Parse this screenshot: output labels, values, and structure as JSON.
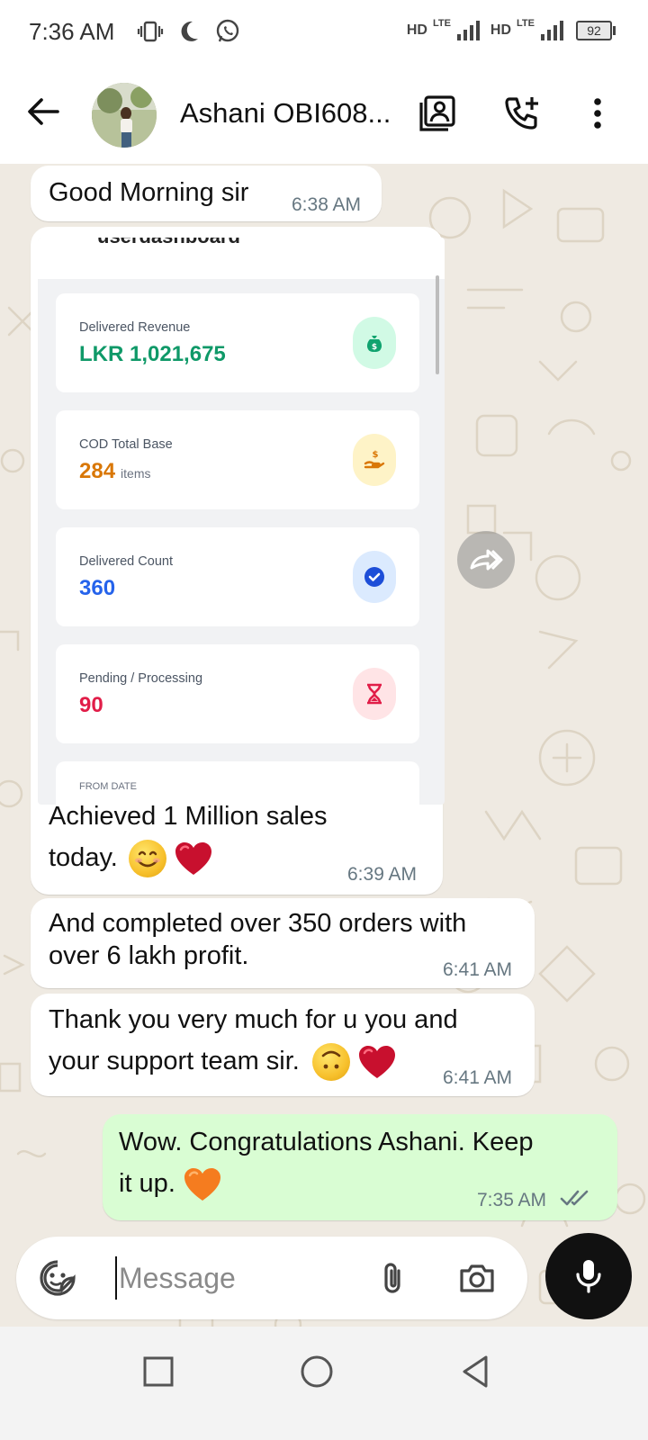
{
  "status_bar": {
    "time": "7:36 AM",
    "network1": "HD",
    "lte1": "LTE",
    "network2": "HD",
    "lte2": "LTE",
    "battery": "92",
    "icons": [
      "vibrate-icon",
      "do-not-disturb-moon-icon",
      "whatsapp-icon"
    ]
  },
  "header": {
    "contact_name": "Ashani OBI608...",
    "icons": [
      "back-arrow-icon",
      "contact-card-icon",
      "add-call-icon",
      "more-vert-icon"
    ]
  },
  "messages": [
    {
      "direction": "in",
      "text": "Good Morning sir",
      "time": "6:38 AM"
    },
    {
      "direction": "in",
      "type": "image",
      "caption_line1": "Achieved 1 Million sales",
      "caption_line2": "today.",
      "time": "6:39 AM"
    },
    {
      "direction": "in",
      "line1": "And completed over 350 orders with",
      "line2": "over 6 lakh profit.",
      "time": "6:41 AM"
    },
    {
      "direction": "in",
      "line1": "Thank you very much for u you and",
      "line2": "your support team sir.",
      "time": "6:41 AM"
    },
    {
      "direction": "out",
      "line1": "Wow. Congratulations Ashani. Keep",
      "line2": "it up.",
      "time": "7:35 AM",
      "status": "read"
    }
  ],
  "screenshot": {
    "title_partial": "userdashboard",
    "cards": [
      {
        "label": "Delivered Revenue",
        "value": "LKR 1,021,675",
        "unit": "",
        "color": "#0f9968",
        "icon_bg": "#d1fae5",
        "icon": "money-bag-icon"
      },
      {
        "label": "COD Total Base",
        "value": "284",
        "unit": "items",
        "color": "#d97706",
        "icon_bg": "#fef3c7",
        "icon": "hand-coin-icon"
      },
      {
        "label": "Delivered Count",
        "value": "360",
        "unit": "",
        "color": "#2563eb",
        "icon_bg": "#dbeafe",
        "icon": "check-circle-icon"
      },
      {
        "label": "Pending / Processing",
        "value": "90",
        "unit": "",
        "color": "#e11d48",
        "icon_bg": "#ffe4e6",
        "icon": "hourglass-icon"
      }
    ],
    "from_date_label": "FROM DATE"
  },
  "composer": {
    "placeholder": "Message",
    "icons": [
      "sticker-icon",
      "attach-paperclip-icon",
      "camera-icon",
      "mic-icon"
    ]
  },
  "nav": {
    "icons": [
      "recents-square-icon",
      "home-circle-icon",
      "back-triangle-icon"
    ]
  },
  "colors": {
    "chat_bg": "#efeae2",
    "outgoing_bubble": "#d9fdd3",
    "incoming_bubble": "#ffffff",
    "tick_read": "#667781"
  }
}
